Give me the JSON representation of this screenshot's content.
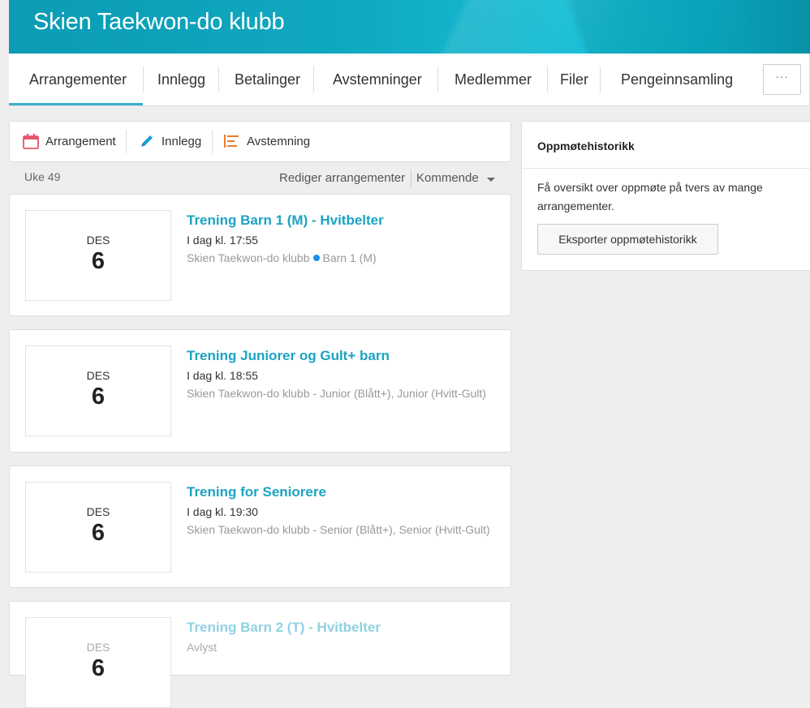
{
  "header": {
    "title": "Skien Taekwon-do klubb"
  },
  "tabs": [
    {
      "label": "Arrangementer"
    },
    {
      "label": "Innlegg"
    },
    {
      "label": "Betalinger"
    },
    {
      "label": "Avstemninger"
    },
    {
      "label": "Medlemmer"
    },
    {
      "label": "Filer"
    },
    {
      "label": "Pengeinnsamling"
    }
  ],
  "more_label": "···",
  "actions": [
    {
      "label": "Arrangement",
      "icon": "calendar-icon"
    },
    {
      "label": "Innlegg",
      "icon": "pencil-icon"
    },
    {
      "label": "Avstemning",
      "icon": "poll-icon"
    }
  ],
  "list_header": {
    "week": "Uke 49",
    "edit": "Rediger arrangementer",
    "filter": "Kommende"
  },
  "events": [
    {
      "month": "DES",
      "day": "6",
      "title": "Trening Barn 1 (M) - Hvitbelter",
      "time": "I dag kl. 17:55",
      "club": "Skien Taekwon-do klubb",
      "group": "Barn 1 (M)"
    },
    {
      "month": "DES",
      "day": "6",
      "title": "Trening Juniorer og Gult+ barn",
      "time": "I dag kl. 18:55",
      "subtitle": "Skien Taekwon-do klubb - Junior (Blått+), Junior (Hvitt-Gult)"
    },
    {
      "month": "DES",
      "day": "6",
      "title": "Trening for Seniorere",
      "time": "I dag kl. 19:30",
      "subtitle": "Skien Taekwon-do klubb - Senior (Blått+), Senior (Hvitt-Gult)"
    },
    {
      "month": "DES",
      "day": "6",
      "title": "Trening Barn 2 (T) - Hvitbelter",
      "time": "Avlyst"
    }
  ],
  "sidebar": {
    "title": "Oppmøtehistorikk",
    "text": "Få oversikt over oppmøte på tvers av mange arrangementer.",
    "button": "Eksporter oppmøtehistorikk"
  },
  "colors": {
    "accent": "#1ba3c2",
    "banner": "#11a9c2",
    "calendar_icon": "#e8546a",
    "pencil_icon": "#1b9ed6",
    "poll_icon": "#f07a2a",
    "status_dot": "#1a8ff0"
  }
}
